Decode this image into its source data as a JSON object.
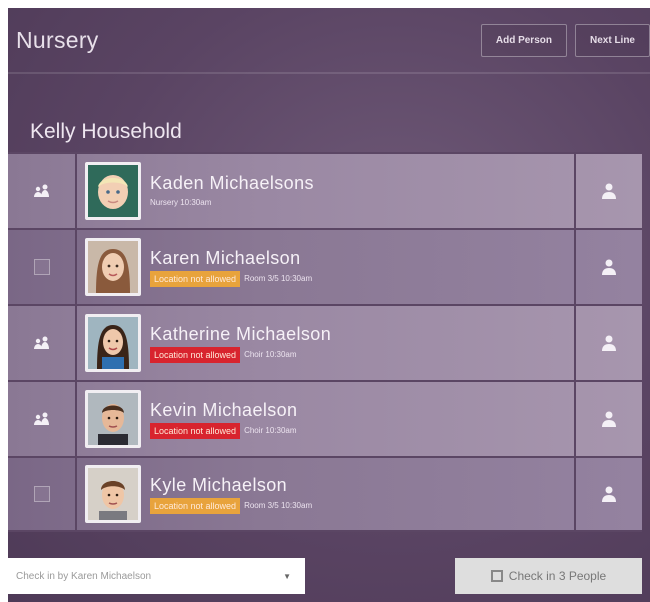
{
  "header": {
    "title": "Nursery",
    "add_person_label": "Add Person",
    "next_label": "Next Line"
  },
  "household": {
    "name": "Kelly Household"
  },
  "people": [
    {
      "name": "Kaden Michaelsons",
      "selected": true,
      "badge": "",
      "meta": "Nursery 10:30am",
      "badge_color": ""
    },
    {
      "name": "Karen Michaelson",
      "selected": false,
      "badge": "Location not allowed",
      "meta": "Room 3/5 10:30am",
      "badge_color": "#e8a33c"
    },
    {
      "name": "Katherine Michaelson",
      "selected": true,
      "badge": "Location not allowed",
      "meta": "Choir 10:30am",
      "badge_color": "#d8242e"
    },
    {
      "name": "Kevin Michaelson",
      "selected": true,
      "badge": "Location not allowed",
      "meta": "Choir 10:30am",
      "badge_color": "#d8242e"
    },
    {
      "name": "Kyle Michaelson",
      "selected": false,
      "badge": "Location not allowed",
      "meta": "Room 3/5 10:30am",
      "badge_color": "#e8a33c"
    }
  ],
  "footer": {
    "checkin_by": "Check in by Karen Michaelson",
    "checkin_button": "Check in 3 People"
  },
  "icons": {
    "selected": "family-check-icon",
    "action": "person-icon"
  }
}
